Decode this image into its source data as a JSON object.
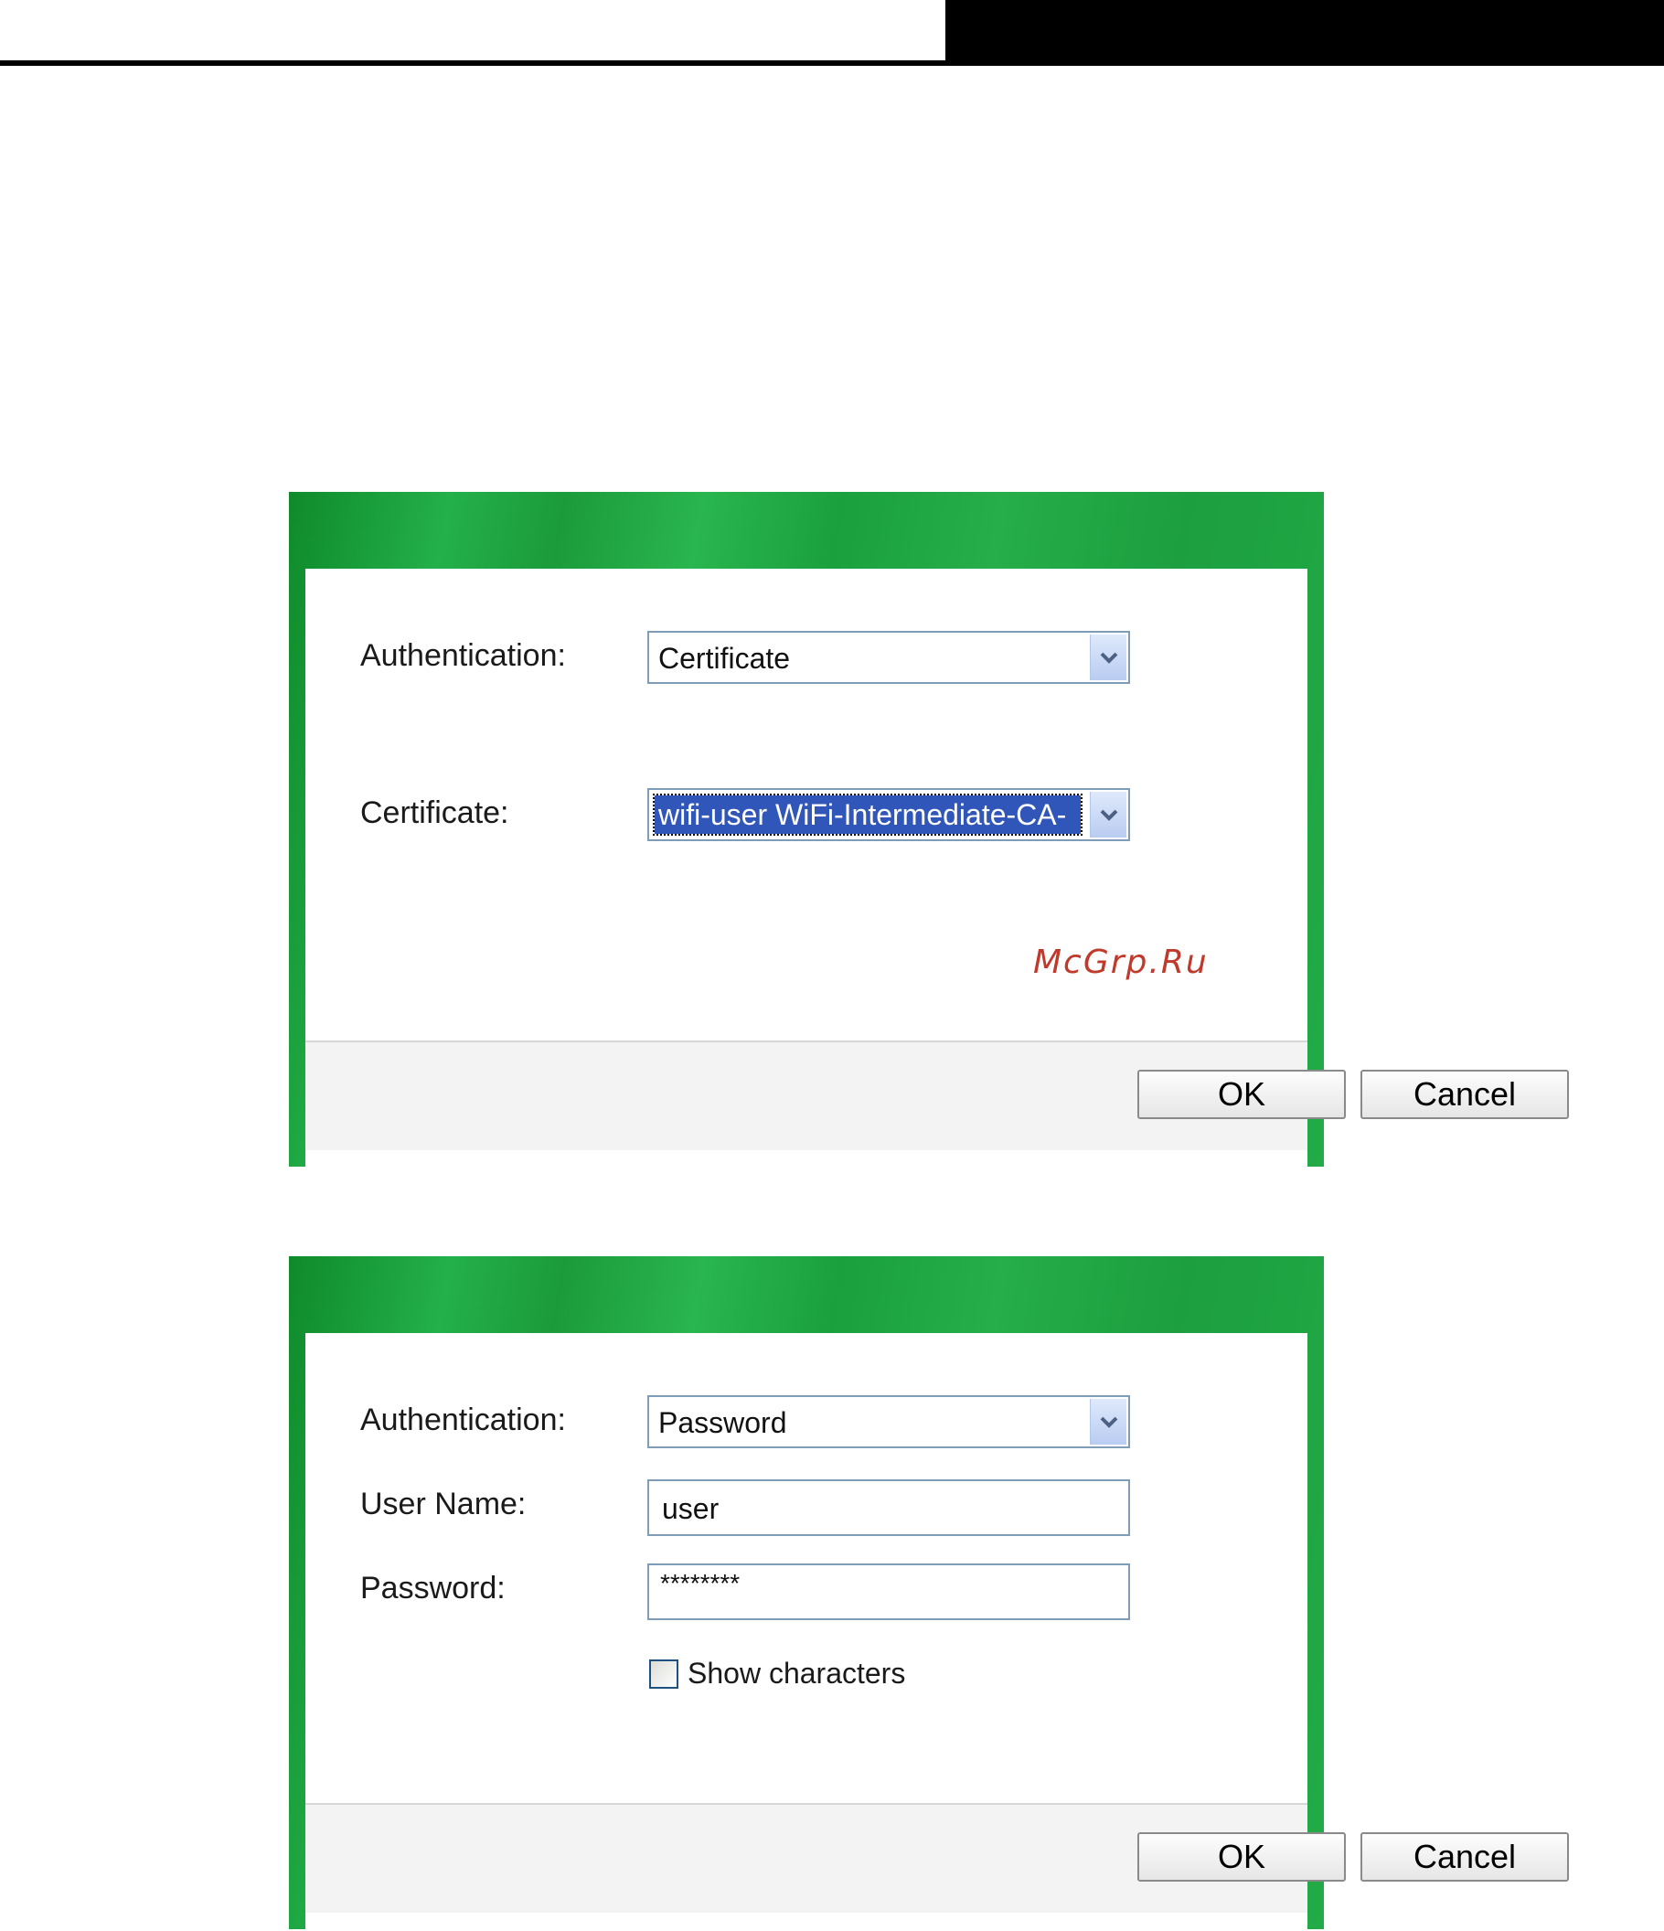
{
  "dialog_certificate": {
    "auth_label": "Authentication:",
    "auth_value": "Certificate",
    "cert_label": "Certificate:",
    "cert_value": "wifi-user  WiFi-Intermediate-CA-",
    "watermark": "McGrp.Ru",
    "ok_label": "OK",
    "cancel_label": "Cancel"
  },
  "dialog_password": {
    "auth_label": "Authentication:",
    "auth_value": "Password",
    "username_label": "User Name:",
    "username_value": "user",
    "password_label": "Password:",
    "password_value": "********",
    "show_chars_label": "Show characters",
    "show_chars_checked": false,
    "ok_label": "OK",
    "cancel_label": "Cancel"
  },
  "colors": {
    "frame_green": "#1fa544",
    "selection_blue": "#2f56b8",
    "field_border": "#7f9db9",
    "watermark_red": "#c0392b"
  },
  "icons": [
    "chevron-down-icon",
    "checkbox"
  ]
}
